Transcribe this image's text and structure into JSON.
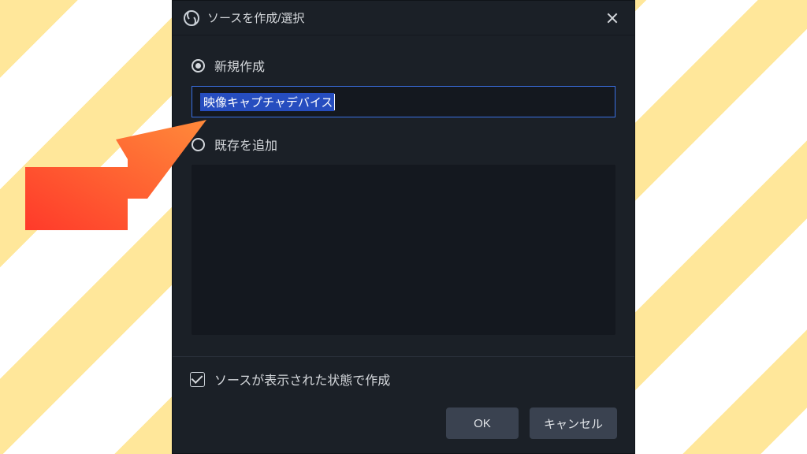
{
  "dialog": {
    "title": "ソースを作成/選択",
    "close": "×"
  },
  "options": {
    "create_new": "新規作成",
    "add_existing": "既存を追加"
  },
  "input": {
    "value": "映像キャプチャデバイス"
  },
  "checkbox": {
    "make_visible": "ソースが表示された状態で作成"
  },
  "buttons": {
    "ok": "OK",
    "cancel": "キャンセル"
  },
  "colors": {
    "dialog_bg": "#1b2027",
    "accent": "#3a6fe3",
    "selection": "#264dbf",
    "arrow_start": "#ff4a2e",
    "arrow_end": "#ff8a3a"
  }
}
